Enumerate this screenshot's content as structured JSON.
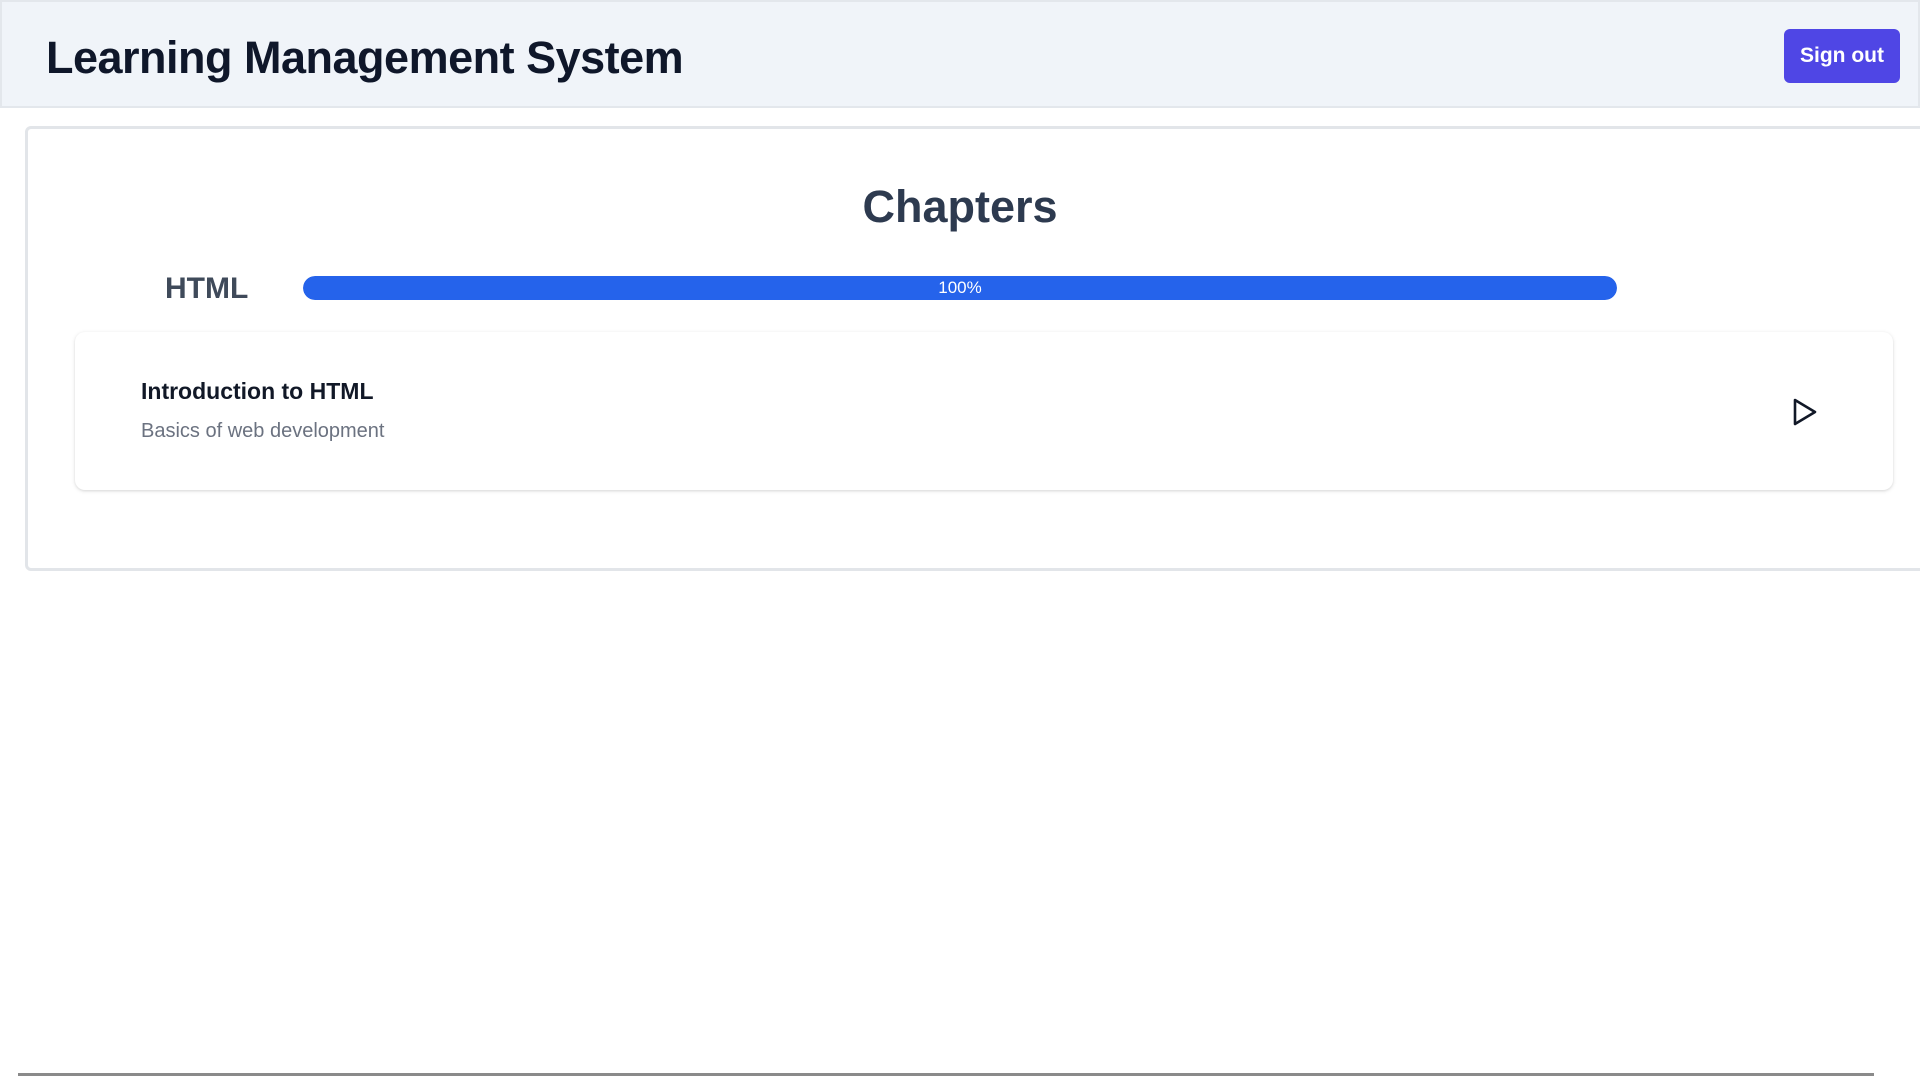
{
  "header": {
    "title": "Learning Management System",
    "signout_label": "Sign out"
  },
  "main": {
    "heading": "Chapters",
    "course": {
      "name": "HTML",
      "progress_percent": 100,
      "progress_label": "100%"
    },
    "chapters": [
      {
        "title": "Introduction to HTML",
        "description": "Basics of web development",
        "action_icon": "play-icon"
      }
    ]
  },
  "colors": {
    "header_bg": "#f0f4f9",
    "signout_bg": "#4f46e5",
    "progress_fill": "#2563eb",
    "heading_text": "#2d3a4f"
  }
}
